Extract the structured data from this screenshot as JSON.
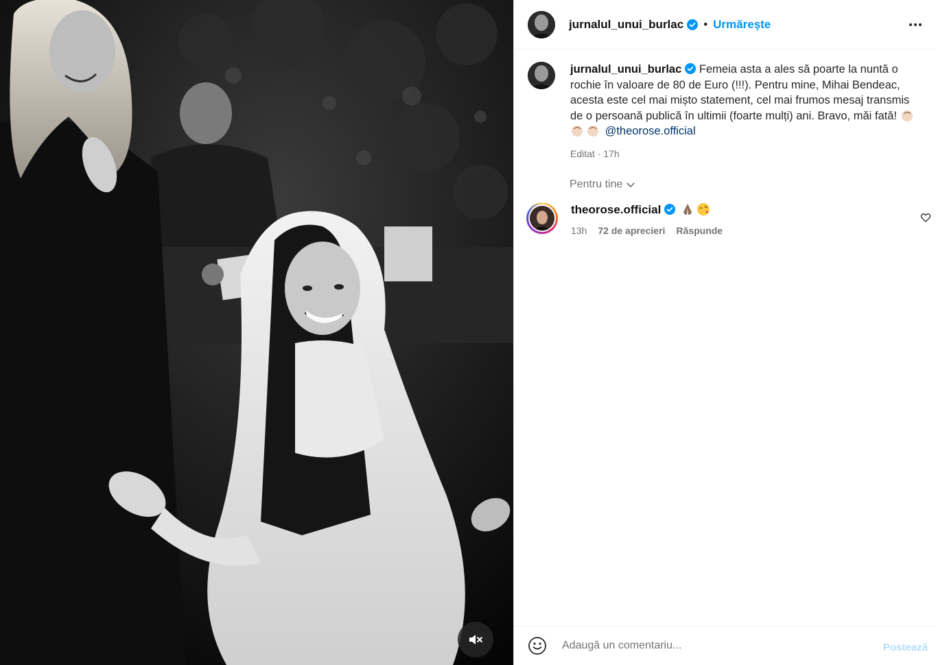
{
  "media": {
    "mute_icon": "speaker-muted-icon"
  },
  "header": {
    "username": "jurnalul_unui_burlac",
    "separator": "•",
    "follow_label": "Urmărește",
    "more_icon": "more-options-icon"
  },
  "caption": {
    "username": "jurnalul_unui_burlac",
    "text": "Femeia asta a ales să poarte la nuntă o rochie în valoare de 80 de Euro (!!!). Pentru mine, Mihai Bendeac, acesta este cel mai mișto statement, cel mai frumos mesaj transmis de o persoană publică în ultimii (foarte mulți) ani. Bravo, măi fată!",
    "mention": "@theorose.official",
    "edited": "Editat · 17h"
  },
  "sort": {
    "label": "Pentru tine"
  },
  "comments": [
    {
      "username": "theorose.official",
      "time": "13h",
      "likes": "72 de aprecieri",
      "reply": "Răspunde"
    }
  ],
  "composer": {
    "placeholder": "Adaugă un comentariu...",
    "post_label": "Postează"
  },
  "colors": {
    "accent": "#0095f6",
    "mention": "#00376b",
    "post_disabled": "#b2dffc",
    "verified": "#0095f6"
  }
}
